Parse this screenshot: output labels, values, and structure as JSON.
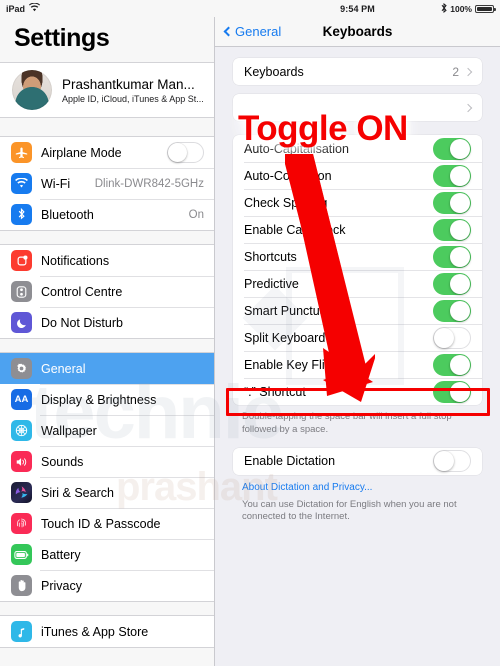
{
  "status_bar": {
    "device_label": "iPad",
    "wifi_icon": "wifi-icon",
    "time": "9:54 PM",
    "bluetooth_icon": "bluetooth-icon",
    "battery_percent": "100%",
    "battery_icon": "battery-full-icon"
  },
  "sidebar": {
    "title": "Settings",
    "profile": {
      "name": "Prashantkumar Man...",
      "subtitle": "Apple ID, iCloud, iTunes & App St...",
      "avatar_icon": "avatar"
    },
    "groups": [
      {
        "items": [
          {
            "label": "Airplane Mode",
            "icon": "airplane-icon",
            "control": "switch",
            "switch_on": false
          },
          {
            "label": "Wi-Fi",
            "icon": "wifi-icon",
            "value": "Dlink-DWR842-5GHz"
          },
          {
            "label": "Bluetooth",
            "icon": "bluetooth-icon",
            "value": "On"
          }
        ]
      },
      {
        "items": [
          {
            "label": "Notifications",
            "icon": "notifications-icon"
          },
          {
            "label": "Control Centre",
            "icon": "control-centre-icon"
          },
          {
            "label": "Do Not Disturb",
            "icon": "moon-icon"
          }
        ]
      },
      {
        "items": [
          {
            "label": "General",
            "icon": "gear-icon",
            "selected": true
          },
          {
            "label": "Display & Brightness",
            "icon": "display-icon"
          },
          {
            "label": "Wallpaper",
            "icon": "wallpaper-icon"
          },
          {
            "label": "Sounds",
            "icon": "speaker-icon"
          },
          {
            "label": "Siri & Search",
            "icon": "siri-icon"
          },
          {
            "label": "Touch ID & Passcode",
            "icon": "fingerprint-icon"
          },
          {
            "label": "Battery",
            "icon": "battery-icon"
          },
          {
            "label": "Privacy",
            "icon": "hand-icon"
          }
        ]
      },
      {
        "items": [
          {
            "label": "iTunes & App Store",
            "icon": "itunes-icon"
          }
        ]
      }
    ]
  },
  "main": {
    "nav": {
      "back_label": "General",
      "back_icon": "chevron-left-icon",
      "title": "Keyboards"
    },
    "keyboards_group": [
      {
        "label": "Keyboards",
        "value": "2",
        "accessory": "chevron-right-icon"
      },
      {
        "label": "",
        "value": "",
        "accessory": "chevron-right-icon"
      }
    ],
    "toggle_group": [
      {
        "label": "Auto-Capitalisation",
        "switch_on": true
      },
      {
        "label": "Auto-Correction",
        "switch_on": true
      },
      {
        "label": "Check Spelling",
        "switch_on": true
      },
      {
        "label": "Enable Caps Lock",
        "switch_on": true
      },
      {
        "label": "Shortcuts",
        "switch_on": true
      },
      {
        "label": "Predictive",
        "switch_on": true
      },
      {
        "label": "Smart Punctuation",
        "switch_on": true
      },
      {
        "label": "Split Keyboard",
        "switch_on": false,
        "highlighted": true
      },
      {
        "label": "Enable Key Flicks",
        "switch_on": true
      },
      {
        "label": "“.” Shortcut",
        "switch_on": true
      }
    ],
    "toggle_group_footnote": "Double-tapping the space bar will insert a full stop followed by a space.",
    "dictation_group": [
      {
        "label": "Enable Dictation",
        "switch_on": false
      }
    ],
    "dictation_link": "About Dictation and Privacy...",
    "dictation_footnote": "You can use Dictation for English when you are not connected to the Internet."
  },
  "annotations": {
    "toggle_on_text": "Toggle ON",
    "arrow_icon": "red-arrow-icon",
    "highlight_box_icon": "red-highlight-box",
    "color": "#f50000"
  },
  "watermark": {
    "line1": "technie",
    "line2": "prashant"
  }
}
